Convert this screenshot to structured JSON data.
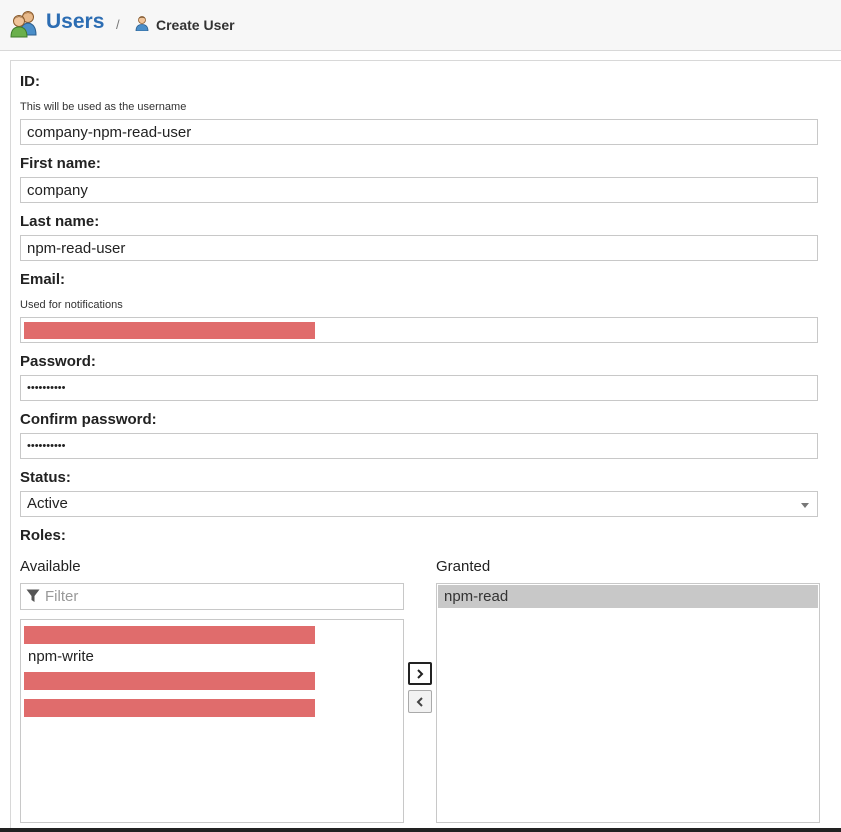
{
  "breadcrumb": {
    "root": "Users",
    "separator": "/",
    "current": "Create User"
  },
  "icons": {
    "users": "users-icon",
    "user": "user-icon",
    "filter": "filter-icon",
    "move_right": "chevron-right-icon",
    "move_left": "chevron-left-icon",
    "select_arrow": "caret-down-icon"
  },
  "form": {
    "id": {
      "label": "ID:",
      "help": "This will be used as the username",
      "value": "company-npm-read-user"
    },
    "first_name": {
      "label": "First name:",
      "value": "company"
    },
    "last_name": {
      "label": "Last name:",
      "value": "npm-read-user"
    },
    "email": {
      "label": "Email:",
      "help": "Used for notifications",
      "value": ""
    },
    "password": {
      "label": "Password:",
      "value": "••••••••••"
    },
    "confirm_password": {
      "label": "Confirm password:",
      "value": "••••••••••"
    },
    "status": {
      "label": "Status:",
      "value": "Active"
    },
    "roles": {
      "label": "Roles:",
      "available_title": "Available",
      "granted_title": "Granted",
      "filter_placeholder": "Filter",
      "available": [
        "",
        "npm-write",
        "",
        ""
      ],
      "granted": [
        "npm-read"
      ]
    }
  },
  "colors": {
    "link": "#2c6db3",
    "redaction": "#e06c6c",
    "selected_item": "#c8c8c8"
  }
}
